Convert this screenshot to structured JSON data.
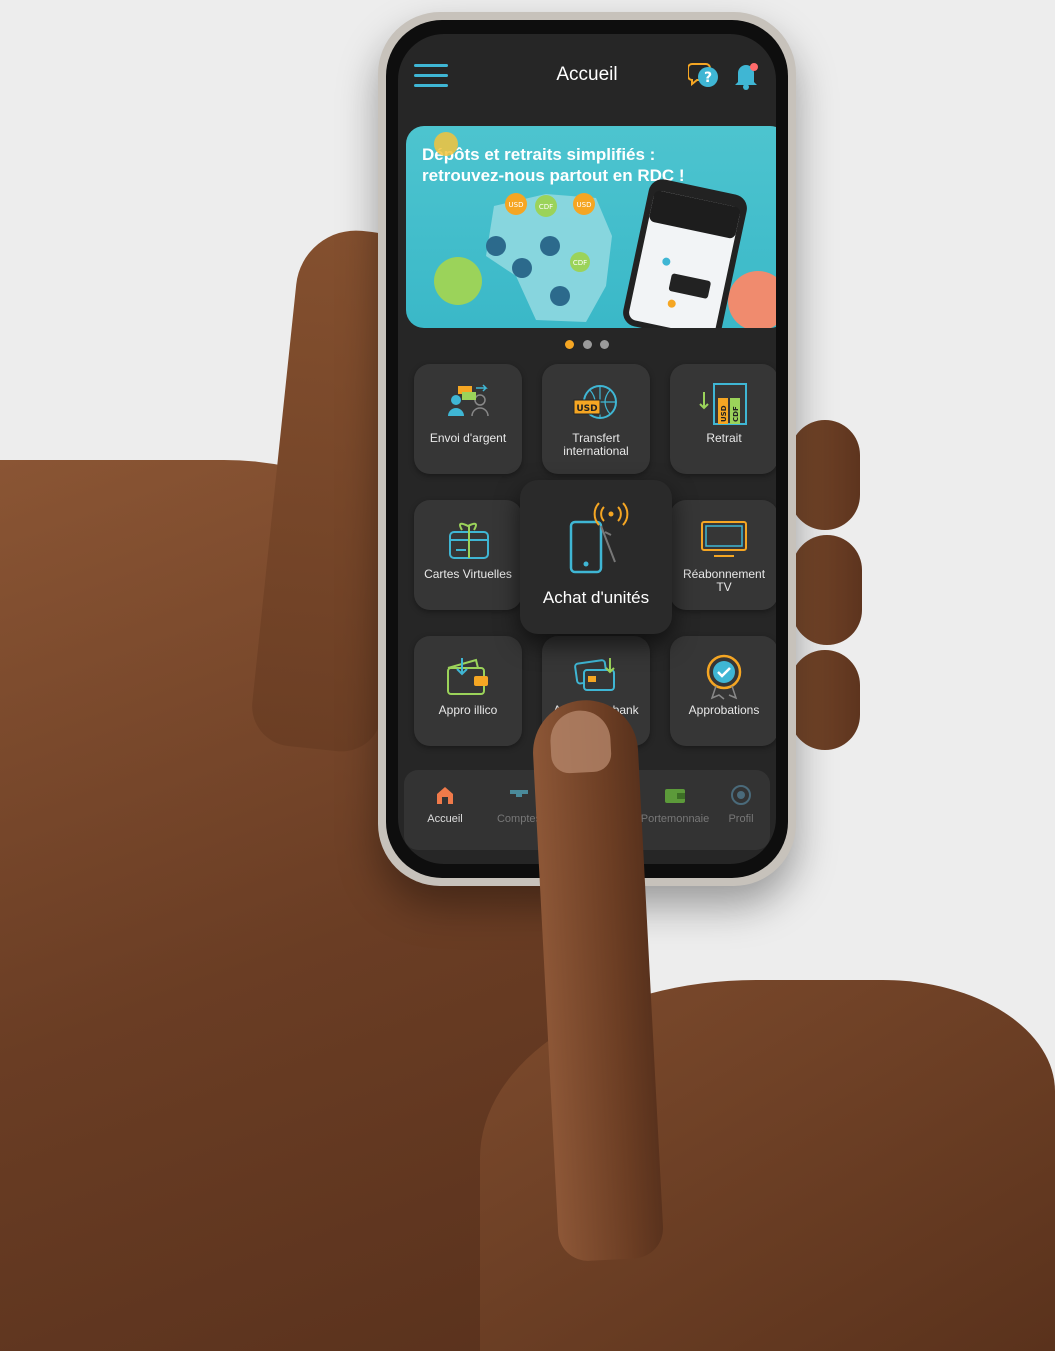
{
  "header": {
    "title": "Accueil",
    "menu_icon": "hamburger-menu-icon",
    "help_icon": "help-chat-icon",
    "notification_icon": "bell-icon"
  },
  "banner": {
    "title_line1": "Dépôts et retraits simplifiés :",
    "title_line2": "retrouvez-nous partout en RDC !",
    "pin_labels": [
      "USD",
      "CDF",
      "USD",
      "CDF"
    ],
    "active_slide": 1,
    "slide_count": 3
  },
  "services": [
    {
      "label": "Envoi d'argent",
      "icon": "send-money-icon"
    },
    {
      "label": "Transfert international",
      "icon": "international-transfer-icon",
      "badge": "USD"
    },
    {
      "label": "Retrait",
      "icon": "withdrawal-icon",
      "badges": [
        "USD",
        "CDF"
      ]
    },
    {
      "label": "Cartes Virtuelles",
      "icon": "virtual-card-icon"
    },
    {
      "label": "Achat d'unités",
      "icon": "airtime-phone-icon"
    },
    {
      "label": "Réabonnement TV",
      "icon": "tv-icon"
    },
    {
      "label": "Appro illico",
      "icon": "wallet-topup-icon"
    },
    {
      "label": "Appro Rawbank",
      "icon": "bank-card-topup-icon"
    },
    {
      "label": "Approbations",
      "icon": "approval-badge-icon"
    }
  ],
  "tabs": [
    {
      "label": "Accueil",
      "icon": "home-icon",
      "active": true
    },
    {
      "label": "Comptes",
      "icon": "accounts-icon",
      "active": false
    },
    {
      "label": "Portemonnaie",
      "icon": "wallet-icon",
      "active": false
    },
    {
      "label": "Profil",
      "icon": "profile-icon",
      "active": false
    }
  ],
  "colors": {
    "accent": "#3fb6d4",
    "highlight": "#f5a623",
    "banner": "#45bfcc",
    "background": "#262626",
    "tile": "#363636"
  }
}
